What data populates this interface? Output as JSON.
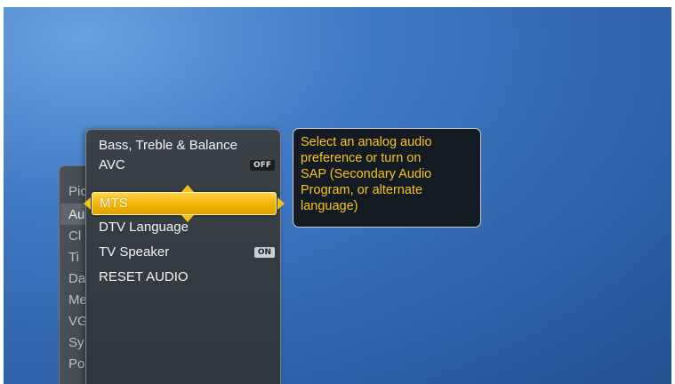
{
  "parent_menu": {
    "items": [
      {
        "label": "Pic",
        "state": "normal"
      },
      {
        "label": "Au",
        "state": "active"
      },
      {
        "label": "Cl",
        "state": "normal"
      },
      {
        "label": "Ti",
        "state": "normal"
      },
      {
        "label": "Da",
        "state": "normal"
      },
      {
        "label": "Me",
        "state": "normal"
      },
      {
        "label": "VG",
        "state": "normal"
      },
      {
        "label": "Sy",
        "state": "normal"
      },
      {
        "label": "Po",
        "state": "normal"
      }
    ]
  },
  "audio_menu": {
    "items": [
      {
        "label": "Bass, Treble & Balance"
      },
      {
        "label": "AVC",
        "badge": "OFF"
      },
      {
        "label": "MTS",
        "selected": true
      },
      {
        "label": "DTV Language"
      },
      {
        "label": "TV Speaker",
        "badge": "ON"
      },
      {
        "label": "RESET AUDIO"
      }
    ]
  },
  "help": {
    "lines": [
      "Select an analog audio",
      "preference or turn on",
      "SAP (Secondary Audio",
      "Program, or alternate",
      "language)"
    ]
  },
  "colors": {
    "background": "#3f78c4",
    "highlight": "#f2b400",
    "help_text": "#f7c321",
    "panel": "#353c42"
  }
}
